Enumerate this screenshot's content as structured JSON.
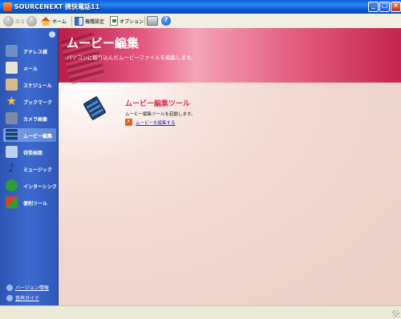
{
  "window": {
    "title": "SOURCENEXT 携快電話11"
  },
  "toolbar": {
    "back_label": "戻る",
    "home_label": "ホーム",
    "model_label": "機種設定",
    "options_label": "オプション"
  },
  "sidebar": {
    "items": [
      {
        "label": "アドレス帳",
        "icon": "address-book-icon",
        "color": "#6f8fc7"
      },
      {
        "label": "メール",
        "icon": "mail-icon",
        "color": "#e8e4d8"
      },
      {
        "label": "スケジュール",
        "icon": "calendar-icon",
        "color": "#d8b98a"
      },
      {
        "label": "ブックマーク",
        "icon": "star-icon",
        "color": "#f2c230"
      },
      {
        "label": "カメラ画像",
        "icon": "camera-icon",
        "color": "#7c8aa6"
      },
      {
        "label": "ムービー編集",
        "icon": "film-icon",
        "color": "#2c5a8f"
      },
      {
        "label": "待受画面",
        "icon": "phone-screen-icon",
        "color": "#bcd0ef"
      },
      {
        "label": "ミュージック",
        "icon": "music-note-icon",
        "color": "#3246a8"
      },
      {
        "label": "インターシンク",
        "icon": "sync-icon",
        "color": "#2f9e3a"
      },
      {
        "label": "便利ツール",
        "icon": "tools-icon",
        "color": "#d0452a"
      }
    ],
    "selected_index": 5,
    "footer": {
      "version_label": "バージョン情報",
      "voice_guide_label": "音声ガイド"
    }
  },
  "banner": {
    "title": "ムービー編集",
    "description": "パソコンに取り込んだムービーファイルを編集します。"
  },
  "tool": {
    "title": "ムービー編集ツール",
    "description": "ムービー編集ツールを起動します。",
    "link_label": "ムービーを編集する"
  },
  "colors": {
    "accent": "#d8304f",
    "sidebar": "#3d6ad0",
    "link": "#1a2fb0"
  }
}
